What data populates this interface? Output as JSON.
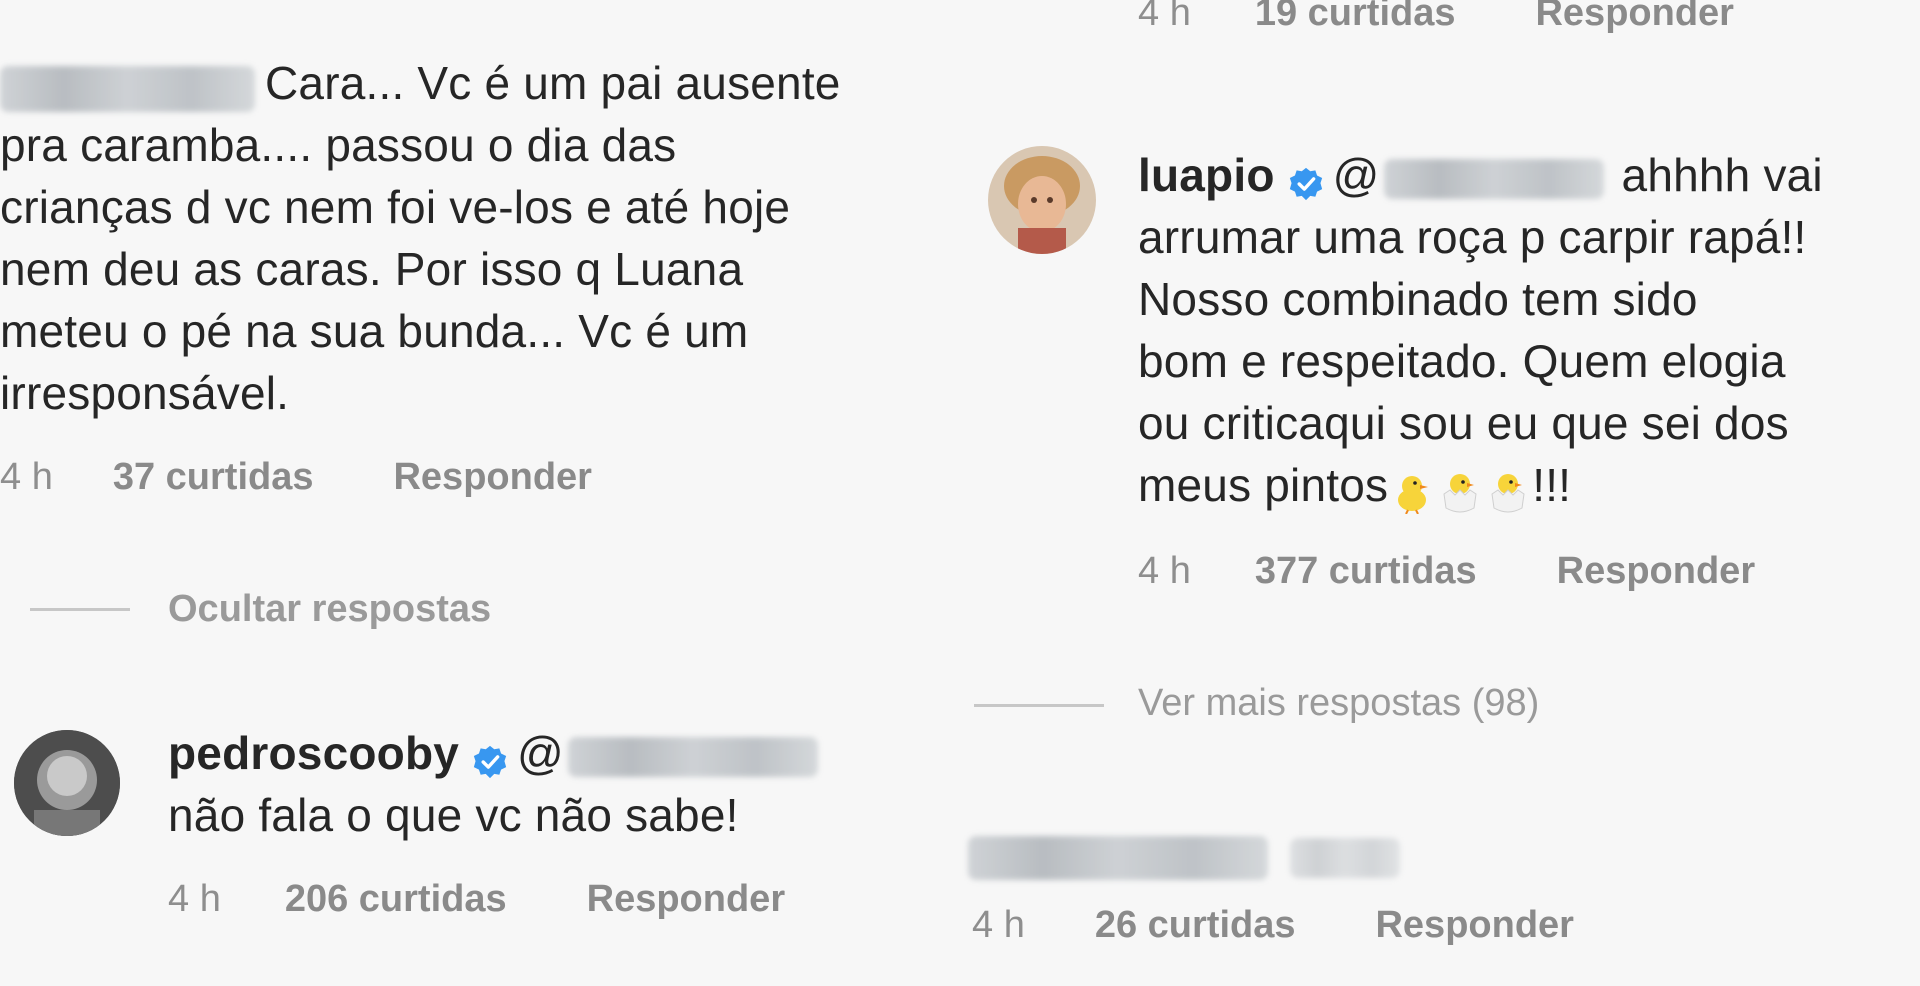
{
  "left": {
    "comment1": {
      "text_lines": [
        "Cara... Vc é  um pai ausente",
        "pra caramba.... passou o dia das",
        "crianças d vc nem foi ve-los e até hoje",
        "nem deu as caras. Por isso q Luana",
        "meteu o pé na sua bunda... Vc é  um",
        "irresponsável."
      ],
      "time": "4 h",
      "likes": "37 curtidas",
      "reply": "Responder"
    },
    "hide_replies": "Ocultar respostas",
    "reply1": {
      "username": "pedroscooby",
      "mention_prefix": "@",
      "text": "não fala o que vc não sabe!",
      "time": "4 h",
      "likes": "206 curtidas",
      "reply": "Responder"
    }
  },
  "right": {
    "top_meta": {
      "time": "4 h",
      "likes": "19 curtidas",
      "reply": "Responder"
    },
    "reply2": {
      "username": "luapio",
      "mention_prefix": "@",
      "first_line_tail": "ahhhh vai",
      "text_lines": [
        "arrumar uma roça p carpir rapá!!",
        "Nosso combinado tem sido",
        "bom e respeitado. Quem elogia",
        "ou criticaqui sou eu que sei dos"
      ],
      "last_line_start": "meus pintos",
      "last_line_end": "!!!",
      "time": "4 h",
      "likes": "377 curtidas",
      "reply": "Responder"
    },
    "more_replies": "Ver mais respostas (98)",
    "comment3": {
      "time": "4 h",
      "likes": "26 curtidas",
      "reply": "Responder"
    }
  },
  "icons": [
    "verified-badge-icon",
    "baby-chick-icon",
    "hatching-chick-icon"
  ],
  "colors": {
    "verified": "#3897f0",
    "text": "#262626",
    "meta": "#8e8e8e"
  }
}
